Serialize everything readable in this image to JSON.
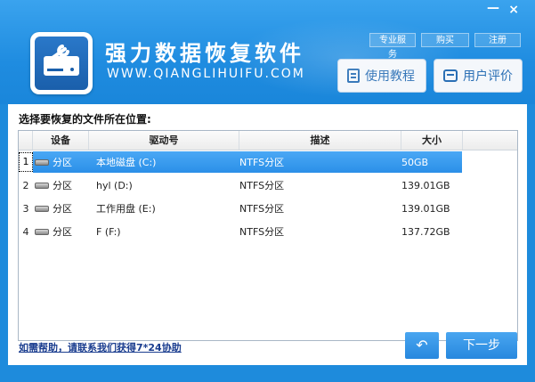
{
  "window": {
    "minimize_label": "—",
    "close_label": "×"
  },
  "header": {
    "title": "强力数据恢复软件",
    "subtitle": "WWW.QIANGLIHUIFU.COM",
    "links": [
      "专业服务",
      "购买",
      "注册"
    ],
    "tutorial_label": "使用教程",
    "review_label": "用户评价",
    "logo_icon": "hard-drive-wrench-icon"
  },
  "main": {
    "prompt": "选择要恢复的文件所在位置:",
    "columns": [
      "设备",
      "驱动号",
      "描述",
      "大小"
    ],
    "rows": [
      {
        "index": "1",
        "device": "分区",
        "drive": "本地磁盘 (C:)",
        "desc": "NTFS分区",
        "size": "50GB",
        "selected": true
      },
      {
        "index": "2",
        "device": "分区",
        "drive": "hyl (D:)",
        "desc": "NTFS分区",
        "size": "139.01GB",
        "selected": false
      },
      {
        "index": "3",
        "device": "分区",
        "drive": "工作用盘 (E:)",
        "desc": "NTFS分区",
        "size": "139.01GB",
        "selected": false
      },
      {
        "index": "4",
        "device": "分区",
        "drive": "F (F:)",
        "desc": "NTFS分区",
        "size": "137.72GB",
        "selected": false
      }
    ]
  },
  "footer": {
    "help_text": "如需帮助，请联系我们获得7*24协助",
    "back_icon": "↶",
    "next_label": "下一步"
  },
  "colors": {
    "header_blue": "#1f8ce0",
    "selection_blue": "#2b8fe8",
    "button_blue": "#2788de"
  }
}
